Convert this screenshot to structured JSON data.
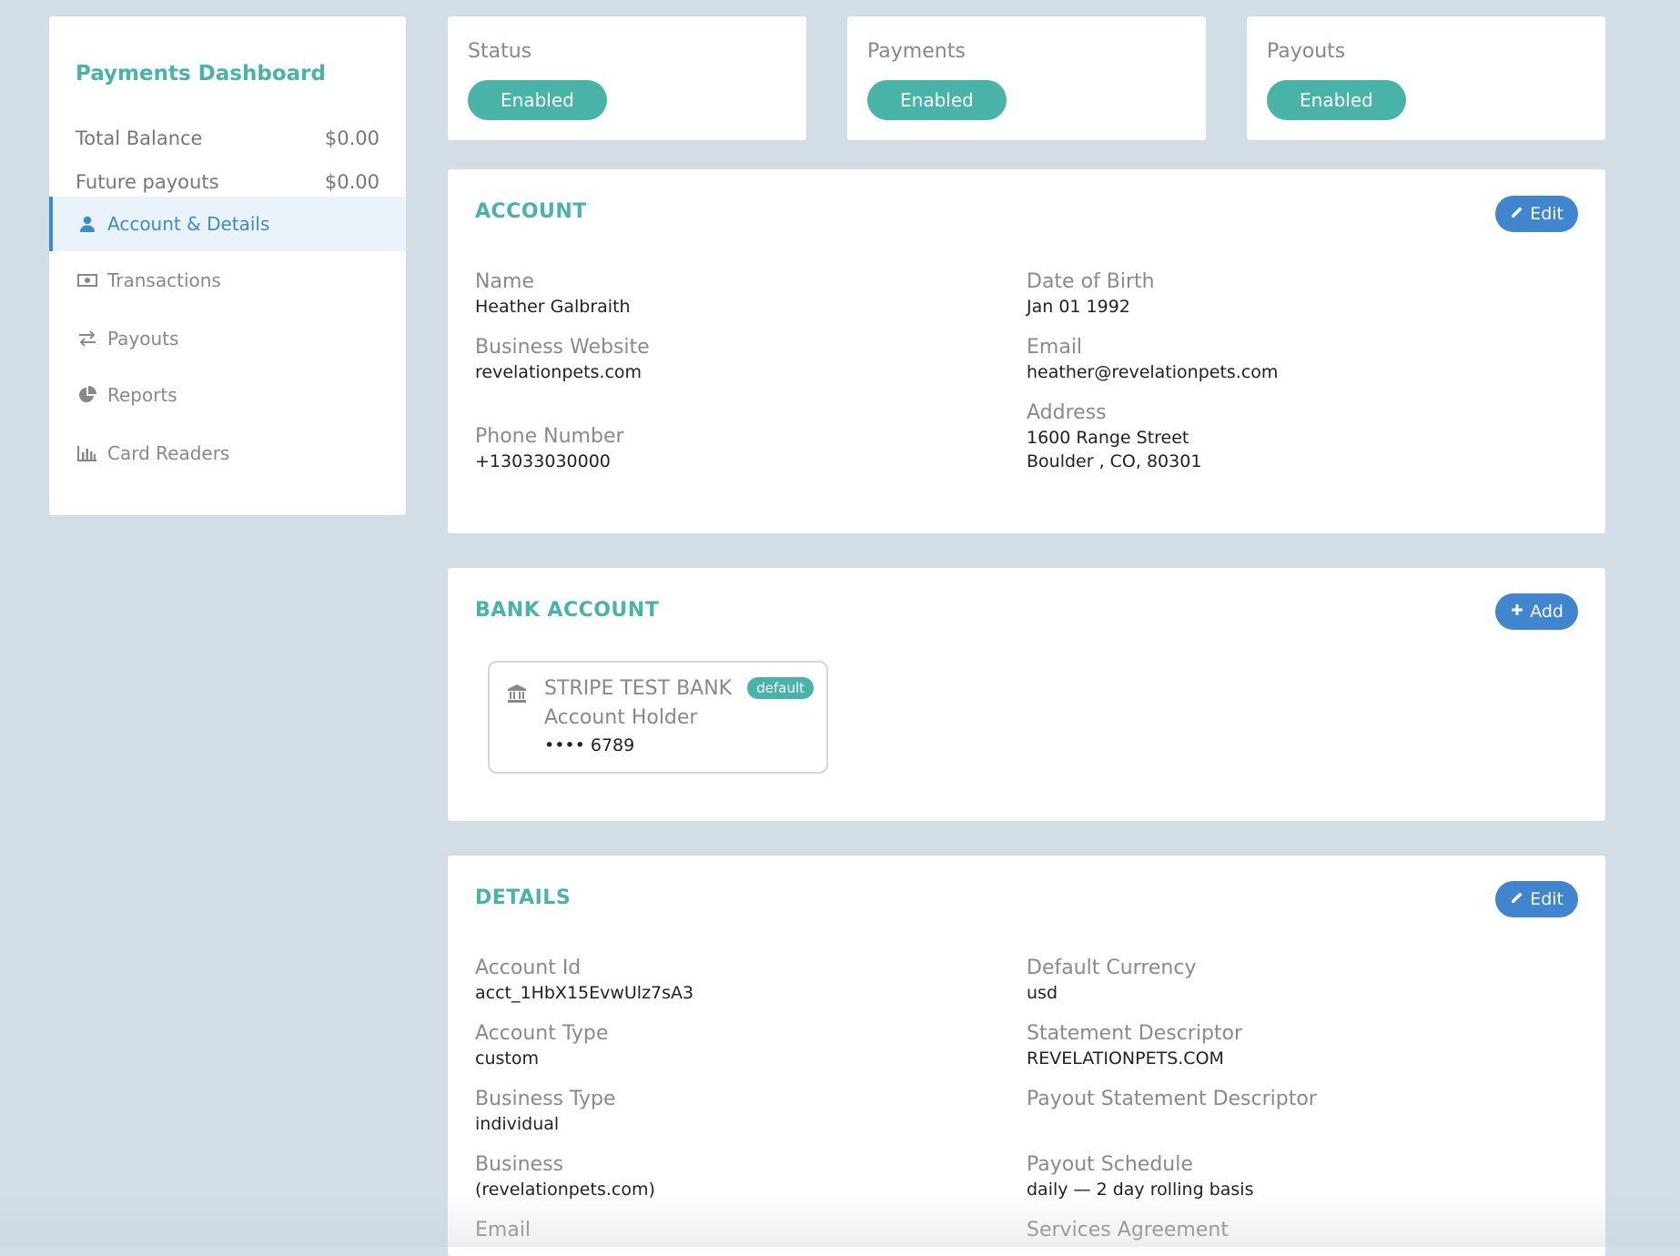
{
  "sidebar": {
    "title": "Payments Dashboard",
    "balances": [
      {
        "label": "Total Balance",
        "value": "$0.00"
      },
      {
        "label": "Future payouts",
        "value": "$0.00"
      }
    ],
    "nav": [
      {
        "label": "Account & Details",
        "icon": "user-icon",
        "active": true
      },
      {
        "label": "Transactions",
        "icon": "money-icon",
        "active": false
      },
      {
        "label": "Payouts",
        "icon": "exchange-icon",
        "active": false
      },
      {
        "label": "Reports",
        "icon": "pie-chart-icon",
        "active": false
      },
      {
        "label": "Card Readers",
        "icon": "bar-chart-icon",
        "active": false
      }
    ]
  },
  "status_cards": [
    {
      "label": "Status",
      "value": "Enabled"
    },
    {
      "label": "Payments",
      "value": "Enabled"
    },
    {
      "label": "Payouts",
      "value": "Enabled"
    }
  ],
  "account": {
    "title": "ACCOUNT",
    "edit_label": "Edit",
    "fields": {
      "name": {
        "label": "Name",
        "value": "Heather Galbraith"
      },
      "website": {
        "label": "Business Website",
        "value": "revelationpets.com"
      },
      "phone": {
        "label": "Phone Number",
        "value": "+13033030000"
      },
      "dob": {
        "label": "Date of Birth",
        "value": "Jan 01 1992"
      },
      "email": {
        "label": "Email",
        "value": "heather@revelationpets.com"
      },
      "address": {
        "label": "Address",
        "line1": "1600 Range Street",
        "line2": "Boulder , CO, 80301"
      }
    }
  },
  "bank_account": {
    "title": "BANK ACCOUNT",
    "add_label": "Add",
    "bank_name": "STRIPE TEST BANK",
    "holder": "Account Holder",
    "number": "•••• 6789",
    "badge": "default"
  },
  "details": {
    "title": "DETAILS",
    "edit_label": "Edit",
    "left": [
      {
        "label": "Account Id",
        "value": "acct_1HbX15EvwUlz7sA3"
      },
      {
        "label": "Account Type",
        "value": "custom"
      },
      {
        "label": "Business Type",
        "value": "individual"
      },
      {
        "label": "Business",
        "value": "(revelationpets.com)"
      },
      {
        "label": "Email",
        "value": ""
      }
    ],
    "right": [
      {
        "label": "Default Currency",
        "value": "usd"
      },
      {
        "label": "Statement Descriptor",
        "value": "REVELATIONPETS.COM"
      },
      {
        "label": "Payout Statement Descriptor",
        "value": ""
      },
      {
        "label": "Payout Schedule",
        "value": "daily — 2 day rolling basis"
      },
      {
        "label": "Services Agreement",
        "value": ""
      }
    ]
  },
  "colors": {
    "teal": "#48b3a7",
    "blue": "#3f86cf",
    "background": "#d3dde6"
  }
}
